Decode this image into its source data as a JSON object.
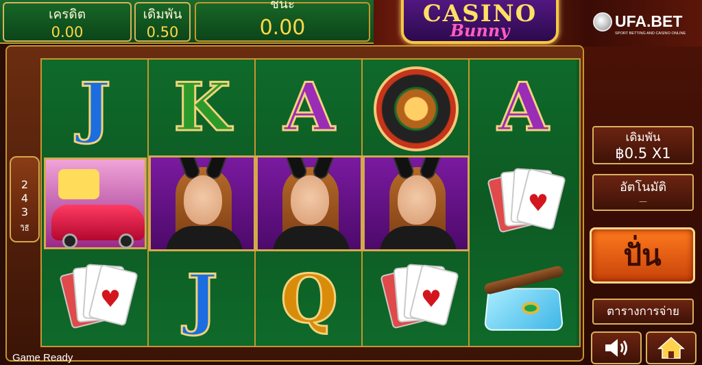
{
  "header": {
    "credit_label": "เครดิต",
    "credit_value": "0.00",
    "bet_label": "เดิมพัน",
    "bet_value": "0.50",
    "win_label": "ชนะ",
    "win_value": "0.00"
  },
  "logos": {
    "game_word1": "CASINO",
    "game_word2": "Bunny",
    "brand": "UFA.BET",
    "brand_tagline": "SPORT BETTING AND CASINO ONLINE"
  },
  "ways": {
    "count": "243",
    "label": "วิธี"
  },
  "reels": {
    "reel1_top": "J",
    "reel2_top": "K",
    "reel3_top": "A",
    "reel5_top": "A",
    "reel2_bottom": "J",
    "reel3_bottom": "Q"
  },
  "controls": {
    "bet_title": "เดิมพัน",
    "bet_amount": "฿0.5 X1",
    "auto_title": "อัตโนมัติ",
    "auto_value": "—",
    "spin_label": "ปั่น",
    "paytable_label": "ตารางการจ่าย"
  },
  "status": "Game Ready",
  "colors": {
    "accent_gold": "#c8962e",
    "felt_green": "#0f6a2a",
    "spin_orange": "#ff7a1d"
  },
  "icons": [
    "speaker-icon",
    "home-icon"
  ]
}
